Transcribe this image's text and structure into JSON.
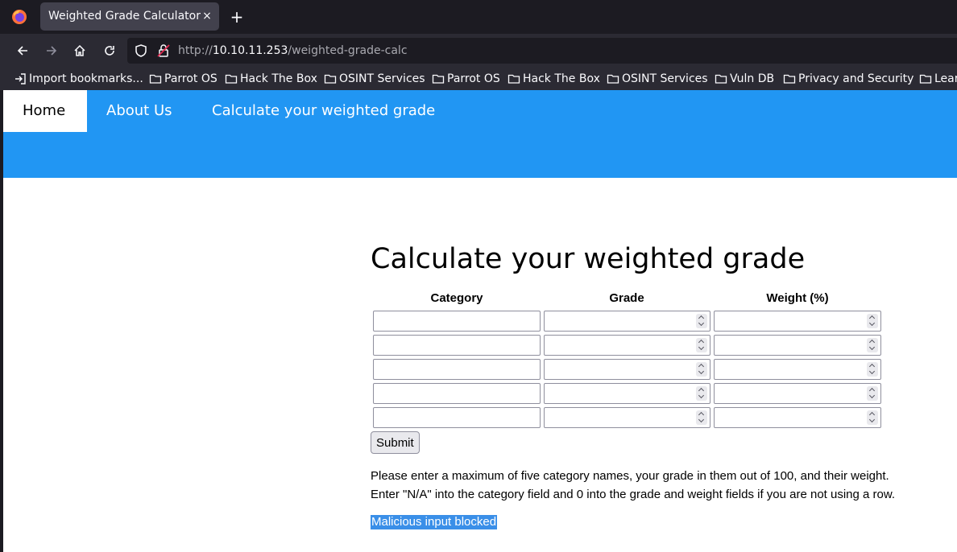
{
  "browser": {
    "tab_title": "Weighted Grade Calculator",
    "tab_close": "×",
    "new_tab": "+",
    "url_scheme": "http://",
    "url_host": "10.10.11.253",
    "url_path": "/weighted-grade-calc",
    "bookmarks": [
      "Import bookmarks...",
      "Parrot OS",
      "Hack The Box",
      "OSINT Services",
      "Parrot OS",
      "Hack The Box",
      "OSINT Services",
      "Vuln DB",
      "Privacy and Security",
      "Lear"
    ]
  },
  "site": {
    "nav": [
      "Home",
      "About Us",
      "Calculate your weighted grade"
    ],
    "active_nav": "Home",
    "accent_color": "#2196f3"
  },
  "form": {
    "title": "Calculate your weighted grade",
    "headers": [
      "Category",
      "Grade",
      "Weight (%)"
    ],
    "rows": [
      {
        "category": "",
        "grade": "",
        "weight": ""
      },
      {
        "category": "",
        "grade": "",
        "weight": ""
      },
      {
        "category": "",
        "grade": "",
        "weight": ""
      },
      {
        "category": "",
        "grade": "",
        "weight": ""
      },
      {
        "category": "",
        "grade": "",
        "weight": ""
      }
    ],
    "submit_label": "Submit",
    "help_line1": "Please enter a maximum of five category names, your grade in them out of 100, and their weight.",
    "help_line2": "Enter \"N/A\" into the category field and 0 into the grade and weight fields if you are not using a row.",
    "result_message": "Malicious input blocked"
  }
}
